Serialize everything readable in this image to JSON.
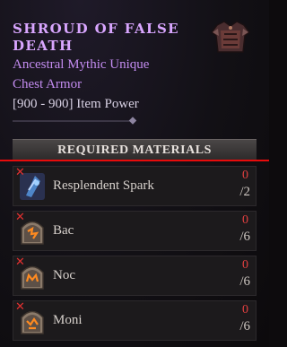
{
  "item": {
    "title_line1": "Shroud of False",
    "title_line2": "Death",
    "rarity": "Ancestral Mythic Unique",
    "slot": "Chest Armor",
    "item_power": "[900 - 900] Item Power",
    "icon": "chest-armor-icon"
  },
  "materials": {
    "header": "Required Materials",
    "rows": [
      {
        "name": "Resplendent Spark",
        "have": "0",
        "need": "/2",
        "icon": "spark-icon"
      },
      {
        "name": "Bac",
        "have": "0",
        "need": "/6",
        "icon": "rune-icon"
      },
      {
        "name": "Noc",
        "have": "0",
        "need": "/6",
        "icon": "rune-icon"
      },
      {
        "name": "Moni",
        "have": "0",
        "need": "/6",
        "icon": "rune-icon"
      }
    ]
  },
  "colors": {
    "title": "#d9a6ff",
    "rarity": "#c38cf0",
    "missing": "#e24040",
    "overlay_line": "#e80b0b"
  }
}
